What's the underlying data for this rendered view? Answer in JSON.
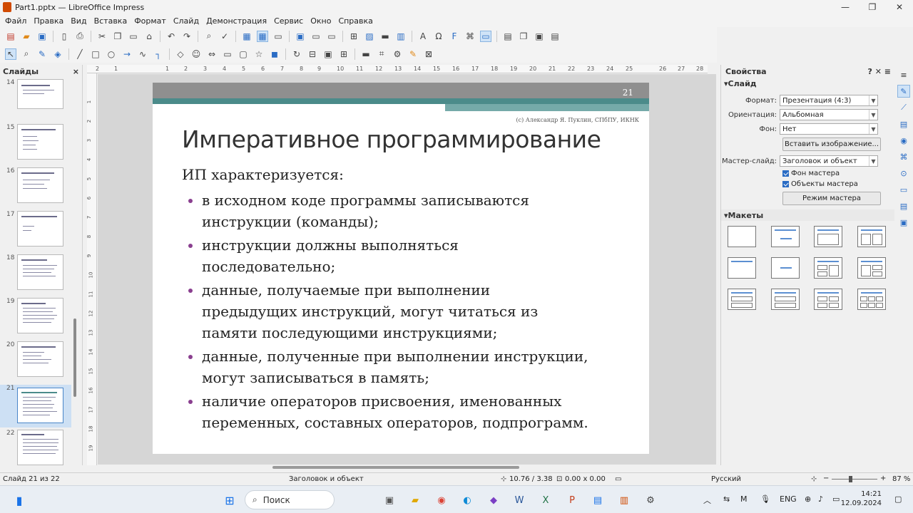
{
  "window": {
    "title": "Part1.pptx — LibreOffice Impress",
    "controls": [
      "—",
      "❐",
      "✕"
    ]
  },
  "menu": [
    "Файл",
    "Правка",
    "Вид",
    "Вставка",
    "Формат",
    "Слайд",
    "Демонстрация",
    "Сервис",
    "Окно",
    "Справка"
  ],
  "slides_panel": {
    "title": "Слайды",
    "close": "×",
    "thumbs": [
      {
        "num": "14"
      },
      {
        "num": "15"
      },
      {
        "num": "16"
      },
      {
        "num": "17"
      },
      {
        "num": "18"
      },
      {
        "num": "19"
      },
      {
        "num": "20"
      },
      {
        "num": "21"
      },
      {
        "num": "22"
      }
    ]
  },
  "ruler_h": [
    "2",
    "1",
    "1",
    "2",
    "3",
    "4",
    "5",
    "6",
    "7",
    "8",
    "9",
    "10",
    "11",
    "12",
    "13",
    "14",
    "15",
    "16",
    "17",
    "18",
    "19",
    "20",
    "21",
    "22",
    "23",
    "24",
    "25",
    "26",
    "27",
    "28"
  ],
  "ruler_v": [
    "1",
    "2",
    "3",
    "4",
    "5",
    "6",
    "7",
    "8",
    "9",
    "10",
    "11",
    "12",
    "13",
    "14",
    "15",
    "16",
    "17",
    "18",
    "19"
  ],
  "slide": {
    "number": "21",
    "copyright": "(c) Александр Я. Пуклин, СПбПУ, ИКНК",
    "title": "Императивное программирование",
    "intro": "ИП характеризуется:",
    "bullets": [
      {
        "l1": "в исходном коде программы записываются",
        "l2": "инструкции (команды);"
      },
      {
        "l1": "инструкции должны выполняться",
        "l2": "последовательно;"
      },
      {
        "l1": "данные, получаемые при выполнении",
        "l2": "предыдущих инструкций, могут читаться из",
        "l3": "памяти последующими инструкциями;"
      },
      {
        "l1": "данные, полученные при выполнении инструкции,",
        "l2": "могут записываться в память;"
      },
      {
        "l1": "наличие операторов присвоения, именованных",
        "l2": "переменных, составных операторов, подпрограмм."
      }
    ]
  },
  "properties": {
    "title": "Свойства",
    "section_slide": "Слайд",
    "format_label": "Формат:",
    "format_value": "Презентация (4:3)",
    "orientation_label": "Ориентация:",
    "orientation_value": "Альбомная",
    "background_label": "Фон:",
    "background_value": "Нет",
    "insert_image": "Вставить изображение...",
    "master_label": "Мастер-слайд:",
    "master_value": "Заголовок и объект",
    "master_bg": "Фон мастера",
    "master_objects": "Объекты мастера",
    "master_mode": "Режим мастера",
    "section_layouts": "Макеты"
  },
  "status": {
    "slide": "Слайд 21 из 22",
    "layout": "Заголовок и объект",
    "position": "10.76 / 3.38",
    "size": "0.00 x 0.00",
    "language": "Русский",
    "zoom": "87 %"
  },
  "taskbar": {
    "search": "Поиск",
    "lang": "ENG",
    "time": "14:21",
    "date": "12.09.2024"
  },
  "colors": {
    "accent": "#4b8b8a",
    "bullet": "#8a3f8f",
    "selection": "#cde0f4"
  }
}
